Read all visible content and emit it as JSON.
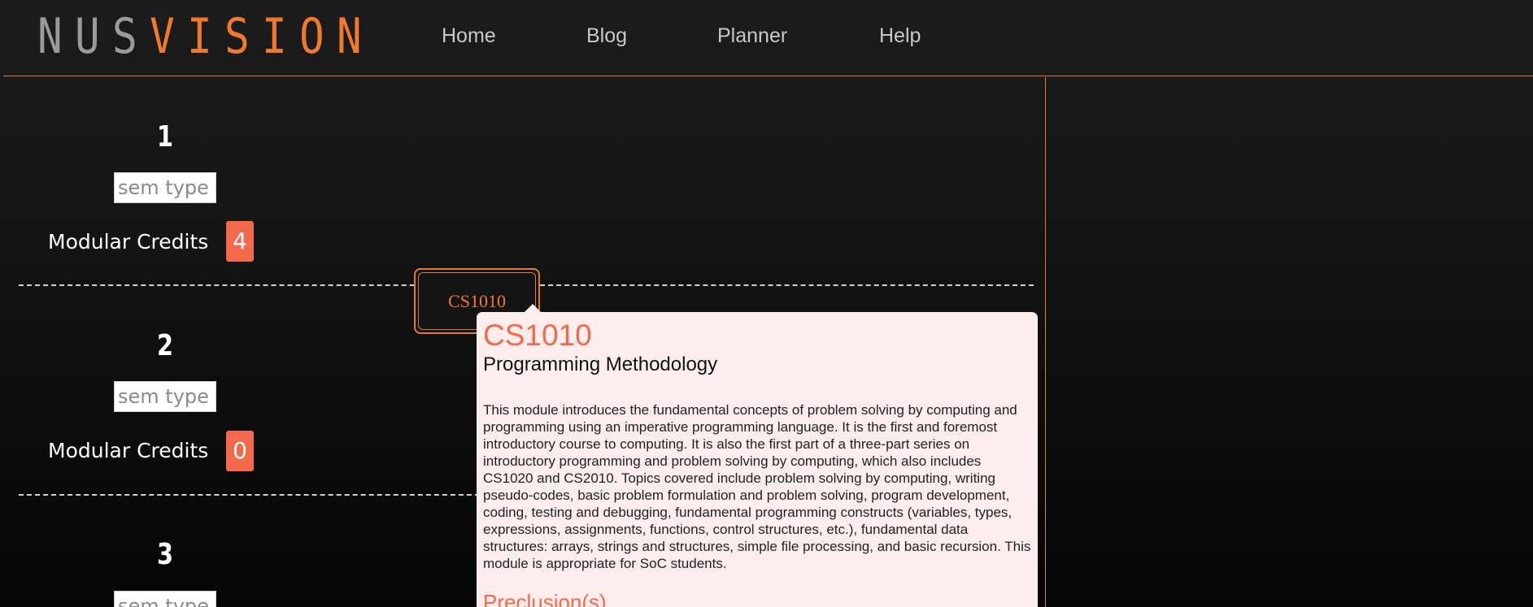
{
  "header": {
    "logo_part1": "NUS",
    "logo_part2": "VISION",
    "nav": [
      "Home",
      "Blog",
      "Planner",
      "Help"
    ]
  },
  "semesters": [
    {
      "number": "1",
      "input_placeholder": "sem type",
      "credits_label": "Modular Credits",
      "credits": "4"
    },
    {
      "number": "2",
      "input_placeholder": "sem type",
      "credits_label": "Modular Credits",
      "credits": "0"
    },
    {
      "number": "3",
      "input_placeholder": "sem type"
    }
  ],
  "module_chip": {
    "code": "CS1010"
  },
  "tooltip": {
    "code": "CS1010",
    "title": "Programming Methodology",
    "description": "This module introduces the fundamental concepts of problem solving by computing and programming using an imperative programming language. It is the first and foremost introductory course to computing. It is also the first part of a three-part series on introductory programming and problem solving by computing, which also includes CS1020 and CS2010. Topics covered include problem solving by computing, writing pseudo-codes, basic problem formulation and problem solving, program development, coding, testing and debugging, fundamental programming constructs (variables, types, expressions, assignments, functions, control structures, etc.), fundamental data structures: arrays, strings and structures, simple file processing, and basic recursion. This module is appropriate for SoC students.",
    "preclusion_heading": "Preclusion(s)"
  },
  "colors": {
    "accent": "#f07a2b",
    "badge": "#f26a4b",
    "tooltip_bg": "#fdeeed"
  }
}
